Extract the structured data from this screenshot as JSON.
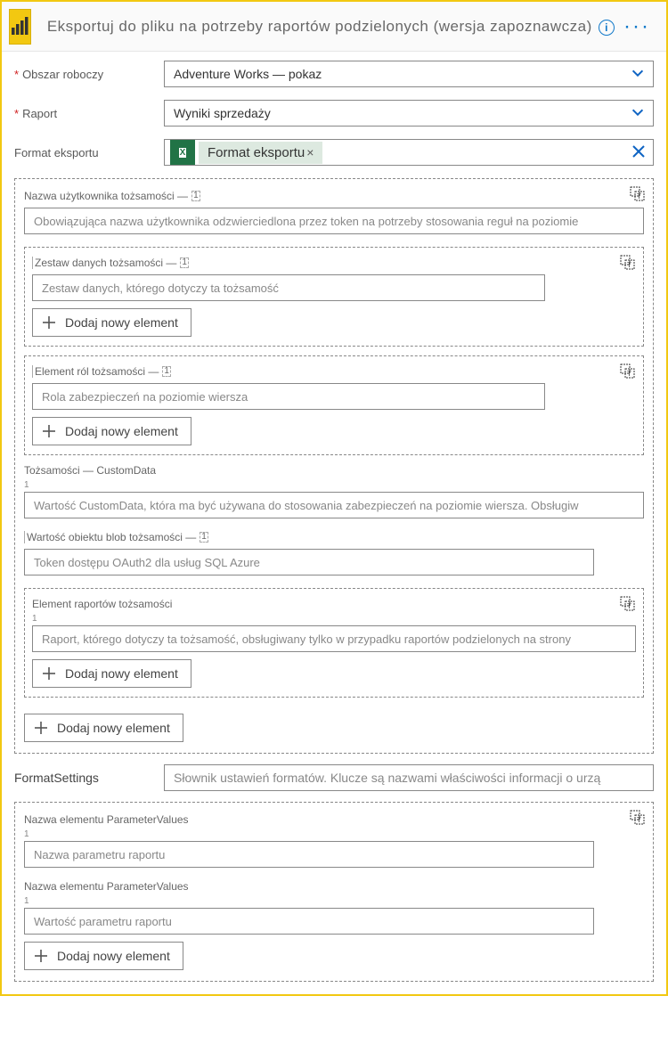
{
  "header": {
    "title": "Eksportuj do pliku na potrzeby raportów podzielonych (wersja zapoznawcza)"
  },
  "fields": {
    "workspace_label": "Obszar roboczy",
    "workspace_value": "Adventure Works — pokaz",
    "report_label": "Raport",
    "report_value": "Wyniki sprzedaży",
    "export_format_label": "Format eksportu",
    "export_format_chip": "Format eksportu"
  },
  "identity": {
    "username_label": "Nazwa użytkownika tożsamości —",
    "username_placeholder": "Obowiązująca nazwa użytkownika odzwierciedlona przez token na potrzeby stosowania reguł na poziomie",
    "dataset_label": "Zestaw danych tożsamości —",
    "dataset_placeholder": "Zestaw danych, którego dotyczy ta tożsamość",
    "roles_label": "Element ról tożsamości —",
    "roles_placeholder": "Rola zabezpieczeń na poziomie wiersza",
    "customdata_label": "Tożsamości — CustomData",
    "customdata_placeholder": "Wartość CustomData, która ma być używana do stosowania zabezpieczeń na poziomie wiersza. Obsługiw",
    "blob_label": "Wartość obiektu blob tożsamości —",
    "blob_placeholder": "Token dostępu OAuth2 dla usług SQL Azure",
    "reports_label": "Element raportów tożsamości",
    "reports_placeholder": "Raport, którego dotyczy ta tożsamość, obsługiwany tylko w przypadku raportów podzielonych na strony"
  },
  "buttons": {
    "add_item": "Dodaj nowy element"
  },
  "formatsettings": {
    "label": "FormatSettings",
    "placeholder": "Słownik ustawień formatów. Klucze są nazwami właściwości informacji o urzą"
  },
  "params": {
    "name_label": "Nazwa elementu ParameterValues",
    "name_placeholder": "Nazwa parametru raportu",
    "value_label": "Nazwa elementu ParameterValues",
    "value_placeholder": "Wartość parametru raportu"
  }
}
